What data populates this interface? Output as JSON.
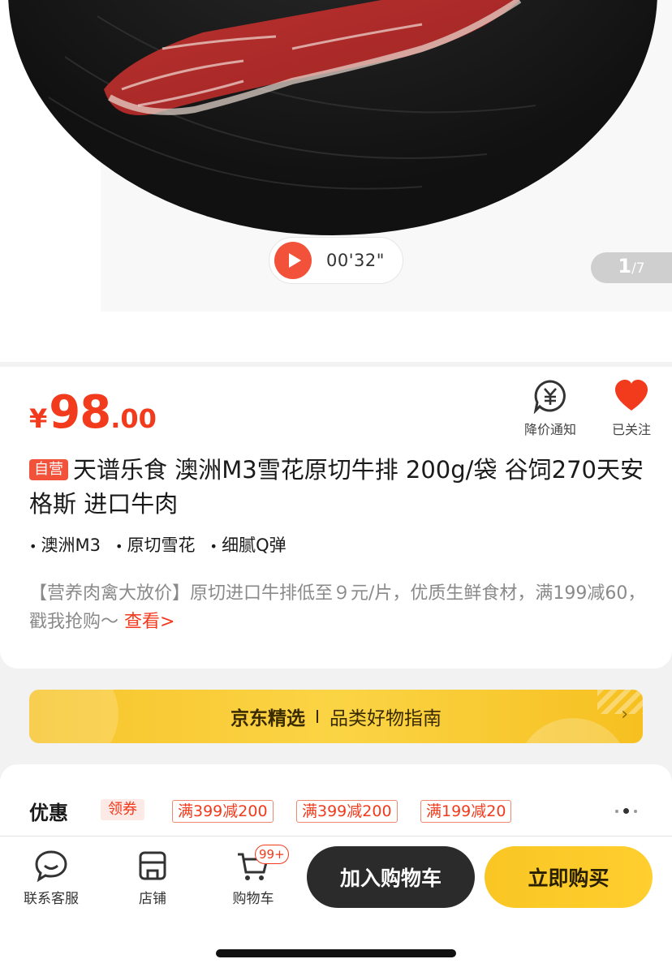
{
  "hero": {
    "video_time": "00'32\"",
    "pager_current": "1",
    "pager_total": "/7"
  },
  "product": {
    "currency": "¥",
    "price_int": "98",
    "price_dec": ".00",
    "self_tag": "自营",
    "title": "天谱乐食 澳洲M3雪花原切牛排 200g/袋  谷饲270天安格斯 进口牛肉",
    "features": [
      "澳洲M3",
      "原切雪花",
      "细腻Q弹"
    ],
    "promo_text": "【营养肉禽大放价】原切进口牛排低至９元/片，优质生鲜食材，满199减60，戳我抢购～",
    "promo_more": "查看>"
  },
  "actions": {
    "notify_label": "降价通知",
    "follow_label": "已关注"
  },
  "banner": {
    "brand": "京东精选",
    "subtitle": "品类好物指南",
    "chevron": "›"
  },
  "coupons": {
    "label": "优惠",
    "get_label": "领券",
    "items": [
      "满399减200",
      "满399减200",
      "满199减20"
    ]
  },
  "bottom_bar": {
    "service_label": "联系客服",
    "shop_label": "店铺",
    "cart_label": "购物车",
    "cart_badge": "99+",
    "add_to_cart": "加入购物车",
    "buy_now": "立即购买"
  },
  "colors": {
    "accent": "#f23a1c",
    "buy_button": "#fbc927",
    "cart_button": "#2b2b2b"
  }
}
